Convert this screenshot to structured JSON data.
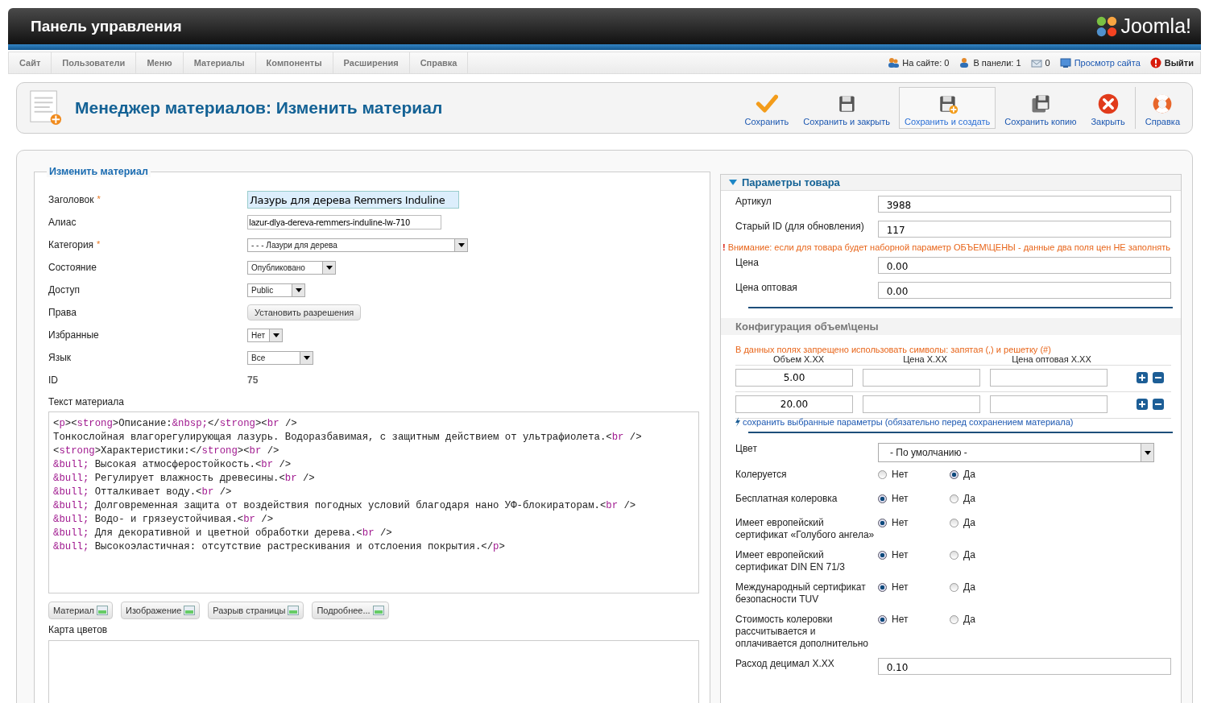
{
  "header": {
    "title": "Панель управления",
    "logo_text": "Joomla!"
  },
  "menu": [
    "Сайт",
    "Пользователи",
    "Меню",
    "Материалы",
    "Компоненты",
    "Расширения",
    "Справка"
  ],
  "status": [
    {
      "kind": "users",
      "text": "На сайте: 0"
    },
    {
      "kind": "admin",
      "text": "В панели: 1"
    },
    {
      "kind": "messages",
      "text": "0"
    },
    {
      "kind": "preview",
      "text": "Просмотр сайта"
    },
    {
      "kind": "logout",
      "text": "Выйти"
    }
  ],
  "toolbar": {
    "title": "Менеджер материалов: Изменить материал",
    "buttons": [
      {
        "kind": "check",
        "label": "Сохранить",
        "highlighted": false
      },
      {
        "kind": "save",
        "label": "Сохранить и закрыть",
        "highlighted": false
      },
      {
        "kind": "save-new",
        "label": "Сохранить и создать",
        "highlighted": true
      },
      {
        "kind": "save-copy",
        "label": "Сохранить копию",
        "highlighted": false
      },
      {
        "kind": "close",
        "label": "Закрыть",
        "highlighted": false
      },
      {
        "kind": "help",
        "label": "Справка",
        "highlighted": false
      }
    ]
  },
  "edit_form": {
    "legend": "Изменить материал",
    "fields": [
      {
        "label": "Заголовок",
        "marker": "*",
        "kind": "title",
        "value": "Лазурь для дерева Remmers Induline"
      },
      {
        "label": "Алиас",
        "kind": "text",
        "value": "lazur-dlya-dereva-remmers-induline-lw-710"
      },
      {
        "label": "Категория",
        "marker": "*",
        "kind": "select",
        "value": "- - - Лазури для дерева"
      },
      {
        "label": "Состояние",
        "kind": "select",
        "value": "Опубликовано"
      },
      {
        "label": "Доступ",
        "kind": "select",
        "value": "Public"
      },
      {
        "label": "Права",
        "kind": "button",
        "value": "Установить разрешения"
      },
      {
        "label": "Избранные",
        "kind": "select",
        "value": "Нет"
      },
      {
        "label": "Язык",
        "kind": "select",
        "value": "Все"
      },
      {
        "label": "ID",
        "kind": "static",
        "value": "75"
      }
    ],
    "editor_label": "Текст материала",
    "editor_lines": [
      "<p><strong>Описание:&nbsp;</strong><br />",
      "Тонкослойная влагорегулирующая лазурь. Водоразбавимая, с защитным действием от ультрафиолета.<br />",
      "<strong>Характеристики:</strong><br />",
      "&bull; Высокая атмосферостойкость.<br />",
      "&bull; Регулирует влажность древесины.<br />",
      "&bull; Отталкивает воду.<br />",
      "&bull; Долговременная защита от воздействия погодных условий благодаря нано УФ-блокираторам.<br />",
      "&bull; Водо- и грязеустойчивая.<br />",
      "&bull; Для декоративной и цветной обработки дерева.<br />",
      "&bull; Высокоэластичная: отсутствие растрескивания и отслоения покрытия.</p>"
    ],
    "editor_buttons": [
      "Материал",
      "Изображение",
      "Разрыв страницы",
      "Подробнее..."
    ],
    "color_map_label": "Карта цветов"
  },
  "product_params": {
    "title": "Параметры товара",
    "expanded": true,
    "fields": [
      {
        "label": "Артикул",
        "value": "3988"
      },
      {
        "label": "Старый ID (для обновления)",
        "value": "117"
      }
    ],
    "warning_mark": "!",
    "warning": "Внимание: если для товара будет наборной параметр ОБЪЕМ\\ЦЕНЫ - данные два поля цен НЕ заполнять",
    "price_fields": [
      {
        "label": "Цена",
        "value": "0.00"
      },
      {
        "label": "Цена оптовая",
        "value": "0.00"
      }
    ],
    "config": {
      "title": "Конфигурация объем\\цены",
      "note": "В данных полях запрещено использовать символы: запятая (,) и решетку (#)",
      "columns": [
        "Объем X.XX",
        "Цена X.XX",
        "Цена оптовая X.XX"
      ],
      "rows": [
        [
          "5.00",
          "",
          ""
        ],
        [
          "20.00",
          "",
          ""
        ]
      ],
      "save_link": "сохранить выбранные параметры (обязательно перед сохранением материала)"
    },
    "color_field": {
      "label": "Цвет",
      "value": "- По умолчанию -"
    },
    "radios": [
      {
        "label": "Колеруется",
        "options": [
          {
            "label": "Нет",
            "selected": false
          },
          {
            "label": "Да",
            "selected": true
          }
        ]
      },
      {
        "label": "Бесплатная колеровка",
        "options": [
          {
            "label": "Нет",
            "selected": true
          },
          {
            "label": "Да",
            "selected": false
          }
        ]
      },
      {
        "label": "Имеет европейский сертификат «Голубого ангела»",
        "options": [
          {
            "label": "Нет",
            "selected": true
          },
          {
            "label": "Да",
            "selected": false
          }
        ]
      },
      {
        "label": "Имеет европейский сертификат DIN EN 71/3",
        "options": [
          {
            "label": "Нет",
            "selected": true
          },
          {
            "label": "Да",
            "selected": false
          }
        ]
      },
      {
        "label": "Международный сертификат безопасности TUV",
        "options": [
          {
            "label": "Нет",
            "selected": true
          },
          {
            "label": "Да",
            "selected": false
          }
        ]
      },
      {
        "label": "Стоимость колеровки рассчитывается и оплачивается дополнительно",
        "options": [
          {
            "label": "Нет",
            "selected": true
          },
          {
            "label": "Да",
            "selected": false
          }
        ]
      }
    ],
    "consumption": {
      "label": "Расход децимал X.XX",
      "value": "0.10"
    }
  }
}
